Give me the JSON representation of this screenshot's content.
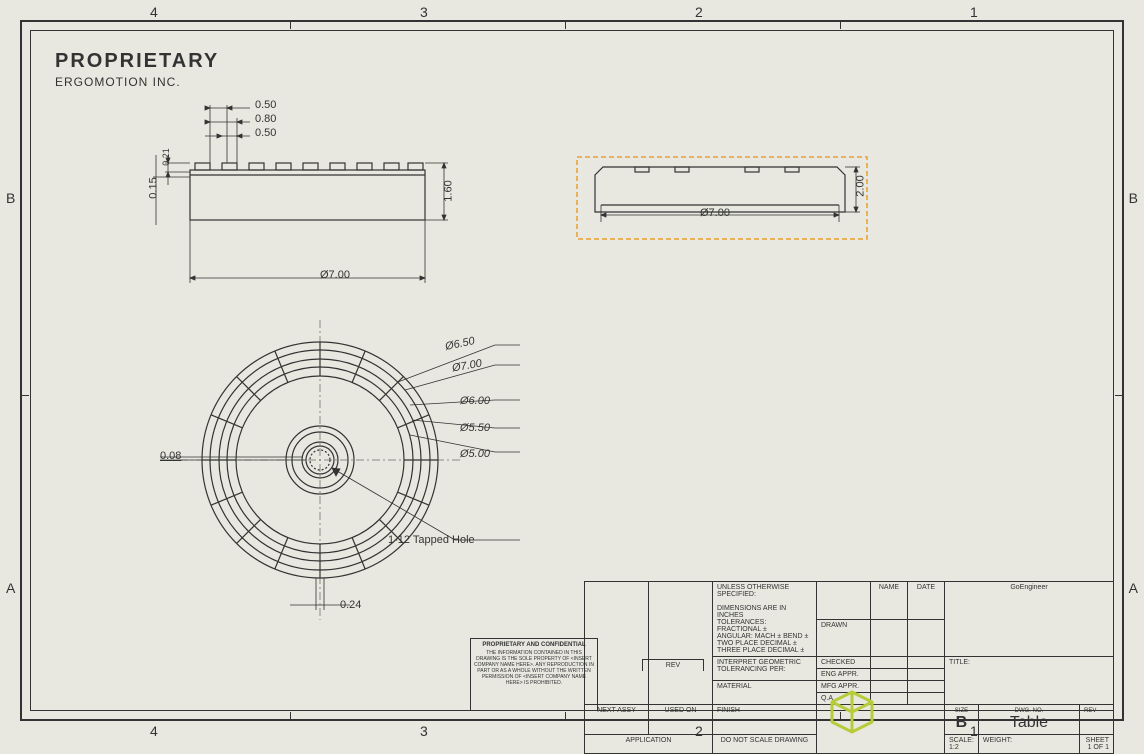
{
  "header": {
    "proprietary": "PROPRIETARY",
    "company": "ERGOMOTION INC."
  },
  "zones": {
    "top": [
      "4",
      "3",
      "2",
      "1"
    ],
    "bottom": [
      "4",
      "3",
      "2",
      "1"
    ],
    "left": [
      "B",
      "A"
    ],
    "right": [
      "B",
      "A"
    ]
  },
  "dimensions": {
    "d050a": "0.50",
    "d080": "0.80",
    "d050b": "0.50",
    "d021": "0.21",
    "d015": "0.15",
    "d160": "1.60",
    "dia700a": "Ø7.00",
    "dia700b": "Ø7.00",
    "d200": "2.00",
    "dia650": "Ø6.50",
    "dia700c": "Ø7.00",
    "dia600": "Ø6.00",
    "dia550": "Ø5.50",
    "dia500": "Ø5.00",
    "d008": "0.08",
    "d024": "0.24",
    "tapped": "1-12 Tapped Hole"
  },
  "title_block": {
    "unless": "UNLESS OTHERWISE SPECIFIED:",
    "dim_in": "DIMENSIONS ARE IN INCHES",
    "tol": "TOLERANCES:",
    "frac": "FRACTIONAL ±",
    "ang": "ANGULAR: MACH ±   BEND ±",
    "two": "TWO PLACE DECIMAL   ±",
    "three": "THREE PLACE DECIMAL  ±",
    "geom": "INTERPRET GEOMETRIC",
    "geom2": "TOLERANCING PER:",
    "mat": "MATERIAL",
    "fin": "FINISH",
    "dns": "DO NOT SCALE DRAWING",
    "name": "NAME",
    "date": "DATE",
    "drawn": "DRAWN",
    "checked": "CHECKED",
    "eng": "ENG APPR.",
    "mfg": "MFG APPR.",
    "qa": "Q.A.",
    "next": "NEXT ASSY",
    "used": "USED ON",
    "app": "APPLICATION",
    "rev_h": "REV",
    "company_name": "GoEngineer",
    "title_lbl": "TITLE:",
    "size_lbl": "SIZE",
    "size": "B",
    "dwg_lbl": "DWG. NO.",
    "dwg": "Table",
    "rev_lbl": "REV",
    "scale_lbl": "SCALE: 1:2",
    "weight_lbl": "WEIGHT:",
    "sheet": "SHEET 1 OF 1"
  },
  "prop_conf": {
    "hdr": "PROPRIETARY AND CONFIDENTIAL",
    "body": "THE INFORMATION CONTAINED IN THIS DRAWING IS THE SOLE PROPERTY OF <INSERT COMPANY NAME HERE>. ANY REPRODUCTION IN PART OR AS A WHOLE WITHOUT THE WRITTEN PERMISSION OF <INSERT COMPANY NAME HERE> IS PROHIBITED."
  },
  "chart_data": {
    "type": "engineering_drawing",
    "part_name": "Table",
    "units": "inches",
    "views": [
      {
        "name": "front_section",
        "diameter": 7.0,
        "height": 1.6,
        "rib_width": 0.5,
        "rib_spacing": 0.8,
        "rib_depth": 0.21,
        "step": 0.15,
        "top_rib_half": 0.5
      },
      {
        "name": "side",
        "diameter": 7.0,
        "height": 2.0,
        "selected": true
      },
      {
        "name": "top",
        "diameters": [
          7.0,
          6.5,
          6.0,
          5.5,
          5.0
        ],
        "center_hole": "1-12 Tapped Hole",
        "small_dims": [
          0.08,
          0.24
        ]
      }
    ],
    "scale": "1:2",
    "sheet_size": "B",
    "revision": "",
    "company": "GoEngineer"
  }
}
